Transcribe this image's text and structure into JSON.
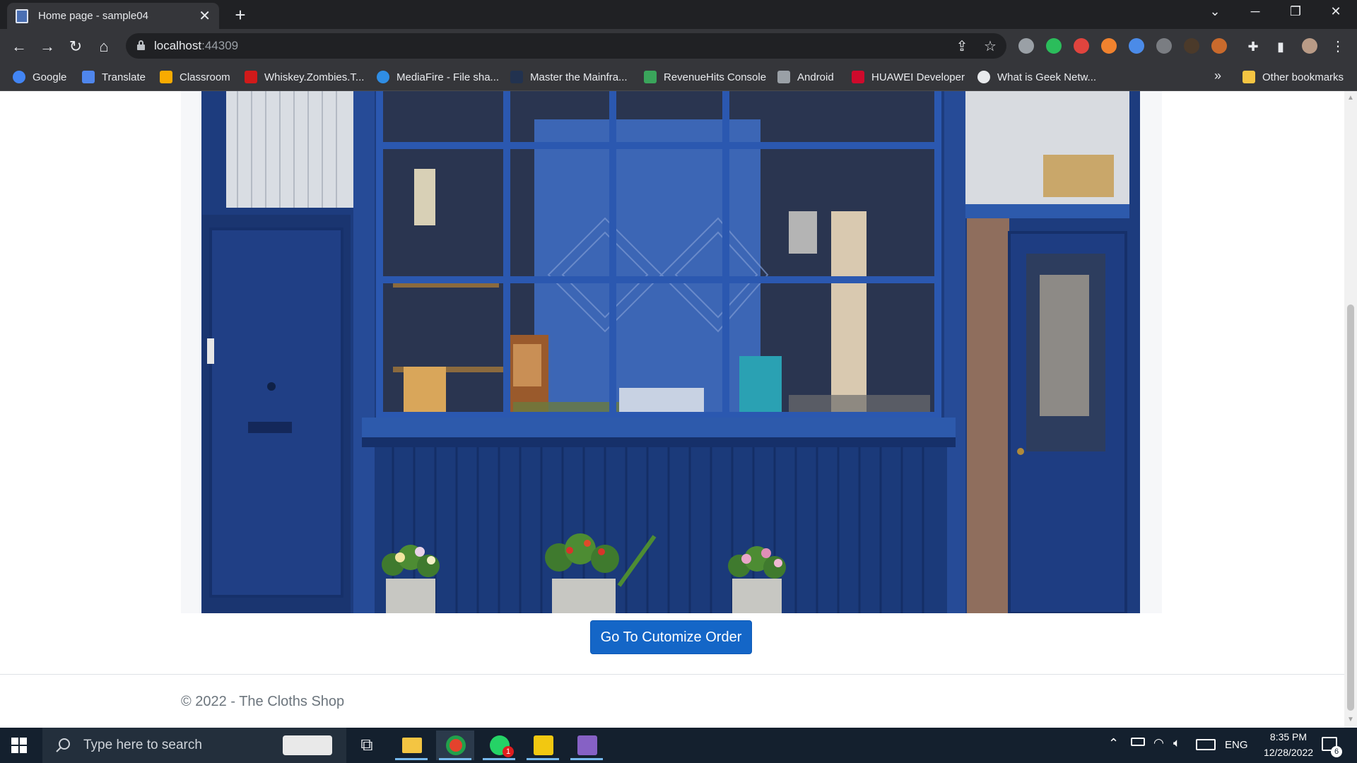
{
  "browser": {
    "tab_title": "Home page - sample04",
    "url_host": "localhost",
    "url_port": ":44309"
  },
  "bookmarks": [
    {
      "label": "Google",
      "color": "#4285f4"
    },
    {
      "label": "Translate",
      "color": "#4f86ec"
    },
    {
      "label": "Classroom",
      "color": "#f9ab00"
    },
    {
      "label": "Whiskey.Zombies.T...",
      "color": "#d11a1a"
    },
    {
      "label": "MediaFire - File sha...",
      "color": "#2f8de4"
    },
    {
      "label": "Master the Mainfra...",
      "color": "#22324f"
    },
    {
      "label": "RevenueHits Console",
      "color": "#3aa55b"
    },
    {
      "label": "Android",
      "color": "#9aa0a6"
    },
    {
      "label": "HUAWEI Developer",
      "color": "#cf0a2c"
    },
    {
      "label": "What is Geek Netw...",
      "color": "#e8eaed"
    }
  ],
  "other_bookmarks": "Other bookmarks",
  "page": {
    "cta_label": "Go To Cutomize Order",
    "footer": "© 2022 - The Cloths Shop"
  },
  "taskbar": {
    "search_placeholder": "Type here to search",
    "language": "ENG",
    "time": "8:35 PM",
    "date": "12/28/2022",
    "notification_count": "6",
    "whatsapp_badge": "1"
  },
  "colors": {
    "accent_button": "#1466c7",
    "shop_blue": "#1f3f86"
  }
}
